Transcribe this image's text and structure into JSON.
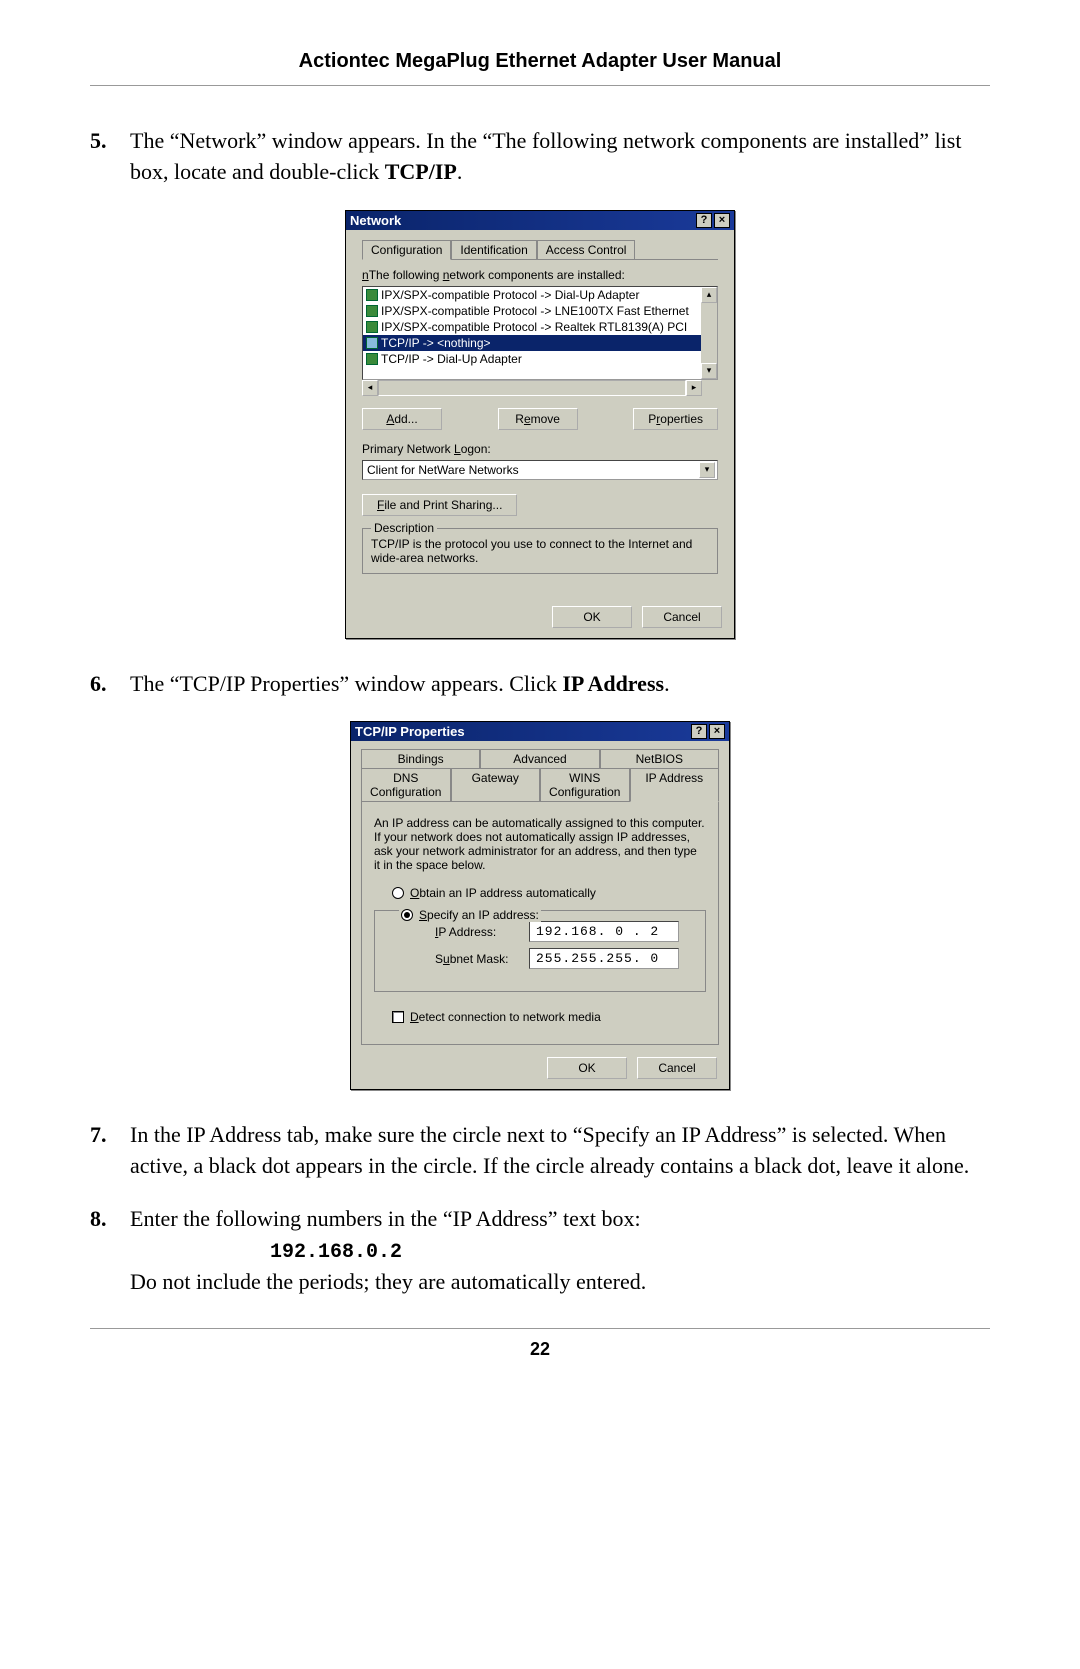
{
  "header": {
    "title": "Actiontec MegaPlug Ethernet Adapter User Manual"
  },
  "footer": {
    "page_number": "22"
  },
  "steps": {
    "s5": {
      "num": "5.",
      "text_a": "The “Network” window appears. In the “The following network components are installed” list box, locate and double-click ",
      "text_bold": "TCP/IP",
      "text_b": "."
    },
    "s6": {
      "num": "6.",
      "text_a": "The “TCP/IP Properties” window appears. Click ",
      "text_bold": "IP Address",
      "text_b": "."
    },
    "s7": {
      "num": "7.",
      "text": "In the IP Address tab, make sure the circle next to “Specify an IP Address” is selected. When active, a black dot appears in the circle. If the circle already contains a black dot, leave it alone."
    },
    "s8": {
      "num": "8.",
      "text_a": "Enter the following numbers in the “IP Address” text box:",
      "ip": "192.168.0.2",
      "text_b": "Do not include the periods; they are automatically entered."
    }
  },
  "network_dialog": {
    "title": "Network",
    "help_btn": "?",
    "close_btn": "×",
    "tabs": {
      "t1": "Configuration",
      "t2": "Identification",
      "t3": "Access Control"
    },
    "list_label": "The following network components are installed:",
    "items": {
      "i1": "IPX/SPX-compatible Protocol -> Dial-Up Adapter",
      "i2": "IPX/SPX-compatible Protocol -> LNE100TX Fast Ethernet",
      "i3": "IPX/SPX-compatible Protocol -> Realtek RTL8139(A) PCI",
      "i4": "TCP/IP -> <nothing>",
      "i5": "TCP/IP -> Dial-Up Adapter"
    },
    "btn_add": "Add...",
    "btn_remove": "Remove",
    "btn_props": "Properties",
    "logon_label": "Primary Network Logon:",
    "logon_value": "Client for NetWare Networks",
    "file_print": "File and Print Sharing...",
    "desc_legend": "Description",
    "desc_text": "TCP/IP is the protocol you use to connect to the Internet and wide-area networks.",
    "ok": "OK",
    "cancel": "Cancel"
  },
  "tcpip_dialog": {
    "title": "TCP/IP Properties",
    "help_btn": "?",
    "close_btn": "×",
    "tabs_top": {
      "t1": "Bindings",
      "t2": "Advanced",
      "t3": "NetBIOS"
    },
    "tabs_bot": {
      "t1": "DNS Configuration",
      "t2": "Gateway",
      "t3": "WINS Configuration",
      "t4": "IP Address"
    },
    "info": "An IP address can be automatically assigned to this computer. If your network does not automatically assign IP addresses, ask your network administrator for an address, and then type it in the space below.",
    "radio_auto": "Obtain an IP address automatically",
    "radio_specify": "Specify an IP address:",
    "ip_label": "IP Address:",
    "ip_value": "192.168. 0 . 2",
    "mask_label": "Subnet Mask:",
    "mask_value": "255.255.255. 0",
    "detect": "Detect connection to network media",
    "ok": "OK",
    "cancel": "Cancel"
  }
}
